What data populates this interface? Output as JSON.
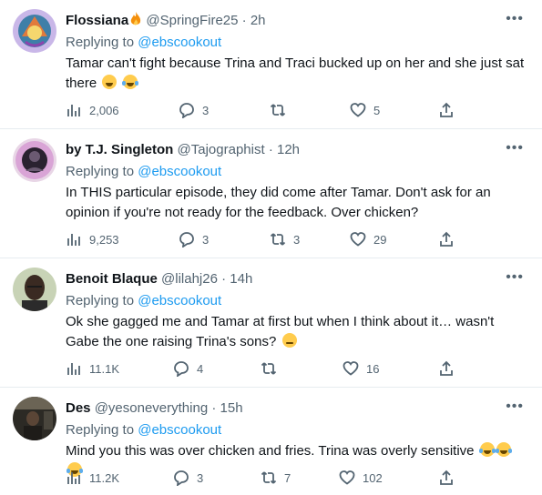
{
  "tweets": [
    {
      "name": "Flossiana",
      "handle": "@SpringFire25",
      "time": "2h",
      "replying_prefix": "Replying to",
      "replying_to": "@ebscookout",
      "text": "Tamar can't fight because Trina and Traci bucked up on her and she just sat there",
      "views": "2,006",
      "replies": "3",
      "retweets": "",
      "likes": "5"
    },
    {
      "name": "by T.J. Singleton",
      "handle": "@Tajographist",
      "time": "12h",
      "replying_prefix": "Replying to",
      "replying_to": "@ebscookout",
      "text": "In THIS particular episode, they did come after Tamar. Don't ask for an opinion if you're not ready for the feedback. Over chicken?",
      "views": "9,253",
      "replies": "3",
      "retweets": "3",
      "likes": "29"
    },
    {
      "name": "Benoit Blaque",
      "handle": "@lilahj26",
      "time": "14h",
      "replying_prefix": "Replying to",
      "replying_to": "@ebscookout",
      "text": "Ok she gagged me and Tamar at first but when I think about it… wasn't Gabe the one raising Trina's sons?",
      "views": "11.1K",
      "replies": "4",
      "retweets": "",
      "likes": "16"
    },
    {
      "name": "Des",
      "handle": "@yesoneverything",
      "time": "15h",
      "replying_prefix": "Replying to",
      "replying_to": "@ebscookout",
      "text": "Mind you this was over chicken and fries. Trina was overly sensitive",
      "views": "11.2K",
      "replies": "3",
      "retweets": "7",
      "likes": "102"
    }
  ],
  "separator": "·",
  "more_icon": "more-dots-icon",
  "colors": {
    "link": "#1d9bf0",
    "muted": "#536471",
    "text": "#0f1419",
    "border": "#e6ecf0"
  }
}
